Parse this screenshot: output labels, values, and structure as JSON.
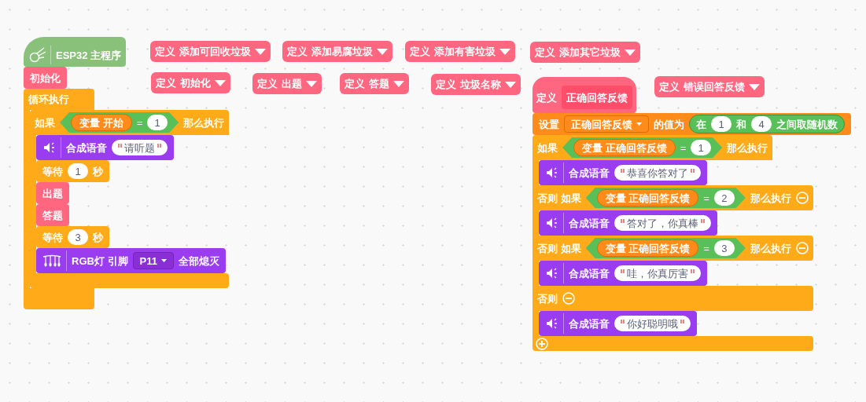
{
  "main_program": {
    "title": "ESP32 主程序",
    "blocks": [
      {
        "kind": "call",
        "label": "初始化"
      },
      {
        "kind": "forever",
        "label": "循环执行",
        "children": [
          {
            "kind": "if",
            "branches": [
              {
                "kind": "if",
                "label": "如果",
                "condition": {
                  "variable": "变量 开始",
                  "operator": "=",
                  "value": "1"
                },
                "then": "那么执行",
                "removable": false,
                "children": [
                  {
                    "kind": "speak",
                    "label": "合成语音",
                    "text": "请听题"
                  },
                  {
                    "kind": "wait",
                    "label": "等待",
                    "value": "1",
                    "unit": "秒"
                  },
                  {
                    "kind": "call",
                    "label": "出题"
                  },
                  {
                    "kind": "call",
                    "label": "答题"
                  },
                  {
                    "kind": "wait",
                    "label": "等待",
                    "value": "3",
                    "unit": "秒"
                  },
                  {
                    "kind": "rgb",
                    "label": "RGB灯 引脚",
                    "pin": "P11",
                    "action": "全部熄灭"
                  }
                ]
              }
            ],
            "add_button": false
          }
        ]
      }
    ]
  },
  "define_blocks": [
    {
      "keyword": "定义",
      "name": "添加可回收垃圾"
    },
    {
      "keyword": "定义",
      "name": "添加易腐垃圾"
    },
    {
      "keyword": "定义",
      "name": "添加有害垃圾"
    },
    {
      "keyword": "定义",
      "name": "添加其它垃圾"
    },
    {
      "keyword": "定义",
      "name": "初始化"
    },
    {
      "keyword": "定义",
      "name": "出题"
    },
    {
      "keyword": "定义",
      "name": "答题"
    },
    {
      "keyword": "定义",
      "name": "垃圾名称"
    },
    {
      "keyword": "定义",
      "name": "错误回答反馈"
    }
  ],
  "feedback_script": {
    "keyword": "定义",
    "name": "正确回答反馈",
    "blocks": [
      {
        "kind": "set",
        "label": "设置",
        "variable": "正确回答反馈",
        "middle": "的值为",
        "random": {
          "prefix": "在",
          "from": "1",
          "and": "和",
          "to": "4",
          "suffix": "之间取随机数"
        }
      },
      {
        "kind": "if",
        "branches": [
          {
            "kind": "if",
            "label": "如果",
            "condition": {
              "variable": "变量 正确回答反馈",
              "operator": "=",
              "value": "1"
            },
            "then": "那么执行",
            "removable": false,
            "children": [
              {
                "kind": "speak",
                "label": "合成语音",
                "text": "恭喜你答对了"
              }
            ]
          },
          {
            "kind": "else_if",
            "label": "否则 如果",
            "condition": {
              "variable": "变量 正确回答反馈",
              "operator": "=",
              "value": "2"
            },
            "then": "那么执行",
            "removable": true,
            "children": [
              {
                "kind": "speak",
                "label": "合成语音",
                "text": "答对了，你真棒"
              }
            ]
          },
          {
            "kind": "else_if",
            "label": "否则 如果",
            "condition": {
              "variable": "变量 正确回答反馈",
              "operator": "=",
              "value": "3"
            },
            "then": "那么执行",
            "removable": true,
            "children": [
              {
                "kind": "speak",
                "label": "合成语音",
                "text": "哇，你真厉害"
              }
            ]
          },
          {
            "kind": "else",
            "label": "否则",
            "removable": true,
            "children": [
              {
                "kind": "speak",
                "label": "合成语音",
                "text": "你好聪明哦"
              }
            ]
          }
        ],
        "add_button": true
      }
    ]
  }
}
